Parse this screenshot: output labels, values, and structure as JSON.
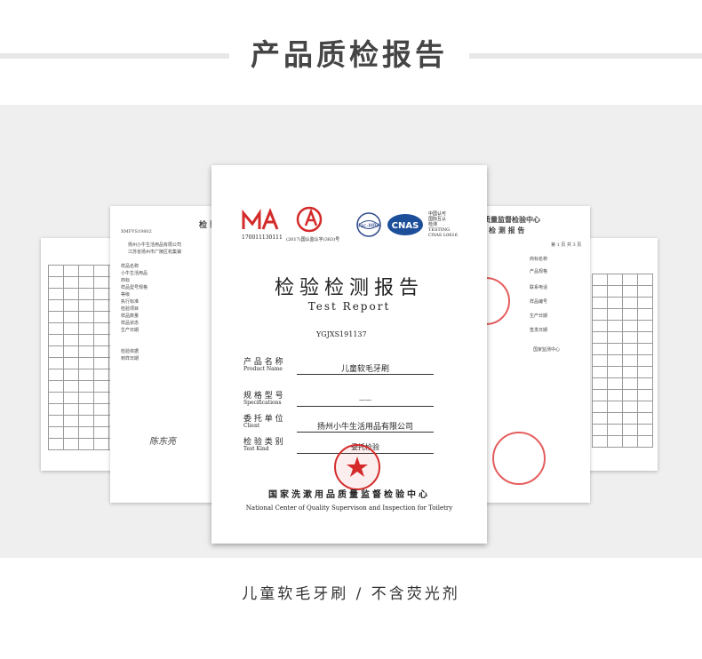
{
  "header": {
    "title": "产品质检报告"
  },
  "caption": "儿童软毛牙刷 / 不含荧光剂",
  "main_report": {
    "logos": [
      {
        "label": "MA",
        "number": "170011130111"
      },
      {
        "label": "AL",
        "number": "(2017)国认监认字(383)号"
      },
      {
        "label": "ilac-MRA"
      },
      {
        "label": "CNAS"
      }
    ],
    "cnas_text": [
      "中国认可",
      "国际互认",
      "检测",
      "TESTING",
      "CNAS L0616"
    ],
    "title_cn": "检验检测报告",
    "title_en": "Test Report",
    "report_no": "YGJXS191137",
    "fields": [
      {
        "label_cn": "产 品 名 称",
        "label_en": "Product Name",
        "value": "儿童软毛牙刷"
      },
      {
        "label_cn": "规 格 型 号",
        "label_en": "Specifications",
        "value": "——"
      },
      {
        "label_cn": "委 托 单 位",
        "label_en": "Client",
        "value": "扬州小牛生活用品有限公司"
      },
      {
        "label_cn": "检 验 类 别",
        "label_en": "Test Kind",
        "value": "委托检验"
      }
    ],
    "stamp_text": "检验检测专用章",
    "org_cn": "国家洗漱用品质量监督检验中心",
    "org_en": "National Center of Quality Supervison and Inspection for Toiletry"
  },
  "left_report": {
    "title": "检 验",
    "no": "XMFYS19802",
    "lines": [
      "扬州小牛生活用品有限公司",
      "江苏省扬州市广陵区杭集镇",
      "样品名称",
      "小牛生活用品",
      "商标",
      "样品型号规格",
      "等级",
      "执行标准",
      "检验项目",
      "样品数量",
      "样品状态",
      "生产日期",
      "检验依据",
      "到样日期"
    ],
    "signature": "陈东亮"
  },
  "right_report": {
    "title": "质量监督检验中心",
    "subtitle": "检 测 报 告",
    "page": "第 1 页 共 3 页",
    "lines": [
      "商标名称",
      "产品规格",
      "联系电话",
      "样品编号",
      "生产日期",
      "签发日期",
      "国家监测中心"
    ]
  },
  "colors": {
    "stamp_red": "#d42a2a",
    "gray_band": "#efefef",
    "title_gray": "#454545"
  }
}
